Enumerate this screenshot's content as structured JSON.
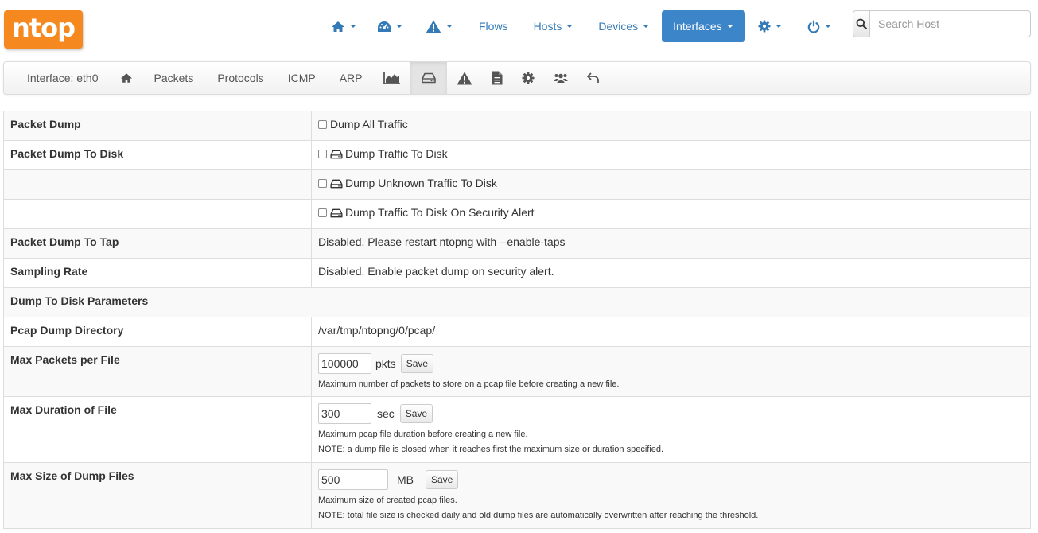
{
  "brand": {
    "logo_text": "ntop",
    "color": "#f5881f"
  },
  "topnav": {
    "items": [
      {
        "icon": "home-icon",
        "dropdown": true
      },
      {
        "icon": "dashboard-icon",
        "dropdown": true
      },
      {
        "icon": "warning-icon",
        "dropdown": true
      },
      {
        "label": "Flows"
      },
      {
        "label": "Hosts",
        "dropdown": true
      },
      {
        "label": "Devices",
        "dropdown": true
      },
      {
        "label": "Interfaces",
        "dropdown": true,
        "active": true
      },
      {
        "icon": "gear-icon",
        "dropdown": true
      },
      {
        "icon": "power-icon",
        "dropdown": true
      }
    ],
    "active_color": "#3c85c9",
    "link_color": "#337ab7"
  },
  "search": {
    "placeholder": "Search Host",
    "icon": "search-icon"
  },
  "subnav": {
    "interface_label": "Interface: eth0",
    "items": [
      {
        "icon": "home-icon"
      },
      {
        "label": "Packets"
      },
      {
        "label": "Protocols"
      },
      {
        "label": "ICMP"
      },
      {
        "label": "ARP"
      },
      {
        "icon": "area-chart-icon"
      },
      {
        "icon": "hdd-icon",
        "active": true
      },
      {
        "icon": "warning-icon"
      },
      {
        "icon": "file-icon"
      },
      {
        "icon": "gear-icon"
      },
      {
        "icon": "users-icon"
      },
      {
        "icon": "undo-icon"
      }
    ]
  },
  "settings": {
    "packet_dump": {
      "label": "Packet Dump",
      "option": "Dump All Traffic",
      "checked": false
    },
    "packet_dump_disk": {
      "label": "Packet Dump To Disk",
      "options": [
        {
          "text": "Dump Traffic To Disk",
          "checked": false
        },
        {
          "text": "Dump Unknown Traffic To Disk",
          "checked": false
        },
        {
          "text": "Dump Traffic To Disk On Security Alert",
          "checked": false
        }
      ]
    },
    "packet_dump_tap": {
      "label": "Packet Dump To Tap",
      "value": "Disabled. Please restart ntopng with --enable-taps"
    },
    "sampling_rate": {
      "label": "Sampling Rate",
      "value": "Disabled. Enable packet dump on security alert."
    },
    "dump_params_header": "Dump To Disk Parameters",
    "pcap_dir": {
      "label": "Pcap Dump Directory",
      "value": "/var/tmp/ntopng/0/pcap/"
    },
    "max_packets": {
      "label": "Max Packets per File",
      "value": "100000",
      "unit": "pkts",
      "save": "Save",
      "note": "Maximum number of packets to store on a pcap file before creating a new file."
    },
    "max_duration": {
      "label": "Max Duration of File",
      "value": "300",
      "unit": "sec",
      "save": "Save",
      "note": "Maximum pcap file duration before creating a new file.",
      "note2": "NOTE: a dump file is closed when it reaches first the maximum size or duration specified."
    },
    "max_size": {
      "label": "Max Size of Dump Files",
      "value": "500",
      "unit": "MB",
      "save": "Save",
      "note": "Maximum size of created pcap files.",
      "note2": "NOTE: total file size is checked daily and old dump files are automatically overwritten after reaching the threshold."
    }
  }
}
